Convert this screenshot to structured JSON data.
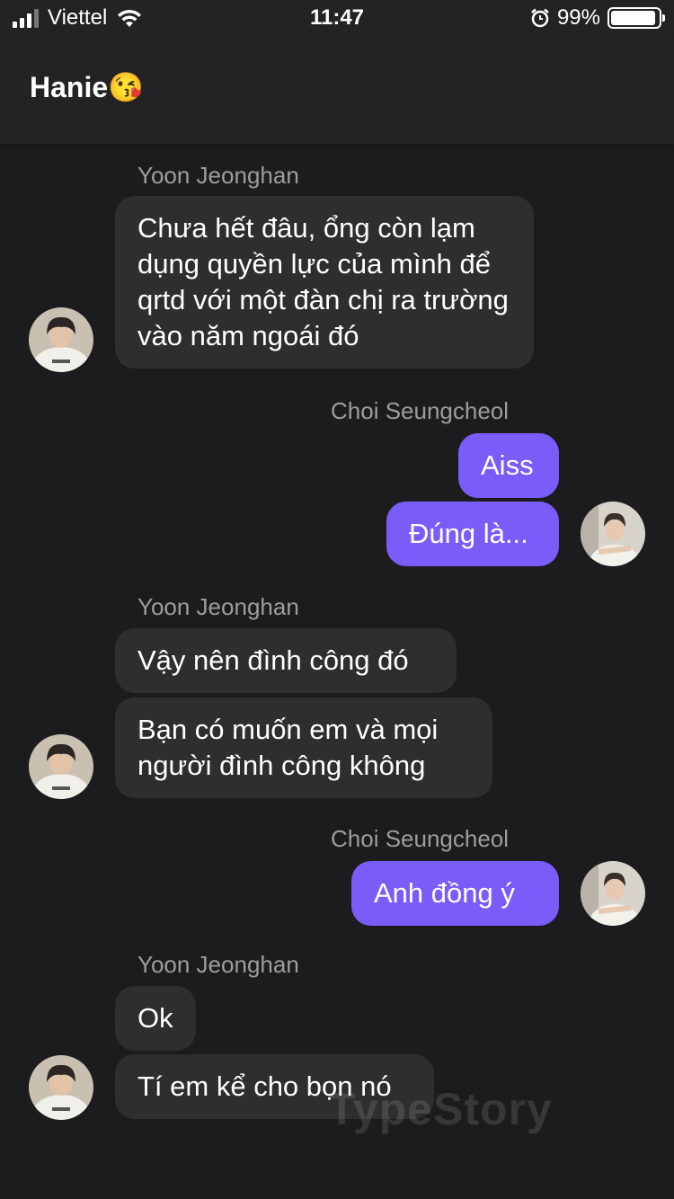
{
  "status_bar": {
    "carrier": "Viettel",
    "time": "11:47",
    "battery": "99%",
    "battery_level": 0.99
  },
  "header": {
    "title": "Hanie😘"
  },
  "messages": [
    {
      "sender": "Yoon Jeonghan",
      "side": "left",
      "bubbles": [
        "Chưa hết đâu, ổng còn lạm dụng quyền lực của mình để qrtd với một đàn chị ra trường vào năm ngoái đó"
      ]
    },
    {
      "sender": "Choi Seungcheol",
      "side": "right",
      "bubbles": [
        "Aiss",
        "Đúng là..."
      ]
    },
    {
      "sender": "Yoon Jeonghan",
      "side": "left",
      "bubbles": [
        "Vậy nên đình công đó",
        "Bạn có muốn em và mọi người đình công không"
      ]
    },
    {
      "sender": "Choi Seungcheol",
      "side": "right",
      "bubbles": [
        "Anh đồng ý"
      ]
    },
    {
      "sender": "Yoon Jeonghan",
      "side": "left",
      "bubbles": [
        "Ok",
        "Tí em kể cho bọn nó"
      ]
    }
  ],
  "watermark": "TypeStory"
}
